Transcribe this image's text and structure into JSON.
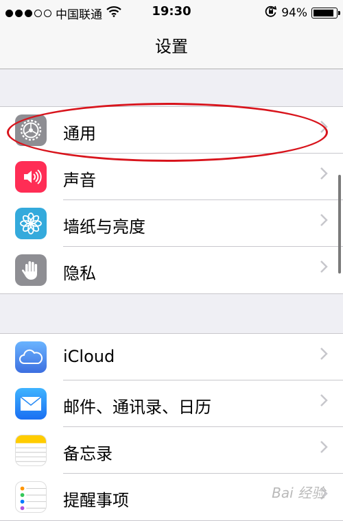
{
  "status_bar": {
    "carrier": "中国联通",
    "time": "19:30",
    "battery_percent": "94%",
    "battery_level": 0.94,
    "signal_bars_filled": 3,
    "signal_bars_total": 5
  },
  "nav": {
    "title": "设置"
  },
  "groups": [
    {
      "rows": [
        {
          "label": "通用",
          "icon": "gear-icon",
          "icon_color": "#8e8e93"
        },
        {
          "label": "声音",
          "icon": "speaker-icon",
          "icon_color": "#ff2d55"
        },
        {
          "label": "墙纸与亮度",
          "icon": "flower-icon",
          "icon_color": "#34aadc"
        },
        {
          "label": "隐私",
          "icon": "hand-icon",
          "icon_color": "#8e8e93"
        }
      ]
    },
    {
      "rows": [
        {
          "label": "iCloud",
          "icon": "cloud-icon",
          "icon_color": "#4f8bf3"
        },
        {
          "label": "邮件、通讯录、日历",
          "icon": "mail-icon",
          "icon_color": "#1a82fb"
        },
        {
          "label": "备忘录",
          "icon": "notes-icon",
          "icon_color": "#ffcc00"
        },
        {
          "label": "提醒事项",
          "icon": "reminders-icon",
          "icon_color": "#ffffff"
        }
      ]
    }
  ],
  "highlight_row": "通用",
  "watermark": "Bai 经验"
}
